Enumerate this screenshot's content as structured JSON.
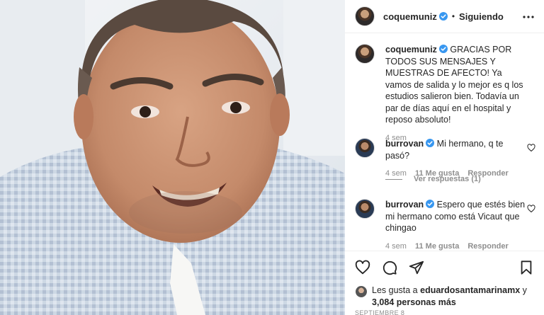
{
  "post": {
    "username": "coquemuniz",
    "separator": "•",
    "follow_status": "Siguiendo"
  },
  "caption": {
    "username": "coquemuniz",
    "text": "GRACIAS POR TODOS SUS MENSAJES Y MUESTRAS DE AFECTO! Ya vamos de salida y lo mejor es q los estudios salieron bien. Todavía un par de días aquí en el hospital y reposo absoluto!",
    "time": "4 sem"
  },
  "comments": [
    {
      "username": "burrovan",
      "text": "Mi hermano, q te pasó?",
      "time": "4 sem",
      "likes": "11 Me gusta",
      "reply_label": "Responder"
    },
    {
      "username": "burrovan",
      "text": "Espero que estés bien mi hermano como está Vicaut que chingao",
      "time": "4 sem",
      "likes": "11 Me gusta",
      "reply_label": "Responder"
    }
  ],
  "view_replies": "Ver respuestas (1)",
  "likes_line": {
    "prefix": "Les gusta a",
    "user": "eduardosantamarinamx",
    "connector": "y",
    "others": "3,084 personas más"
  },
  "date": "SEPTIEMBRE 8",
  "icons": {
    "verified": "verified-badge-icon",
    "more": "more-horizontal-icon",
    "like": "heart-icon",
    "comment": "comment-bubble-icon",
    "share": "paper-plane-icon",
    "save": "bookmark-icon"
  },
  "colors": {
    "verified": "#3897f0",
    "text": "#262626",
    "muted": "#8e8e8e",
    "border": "#efefef"
  }
}
